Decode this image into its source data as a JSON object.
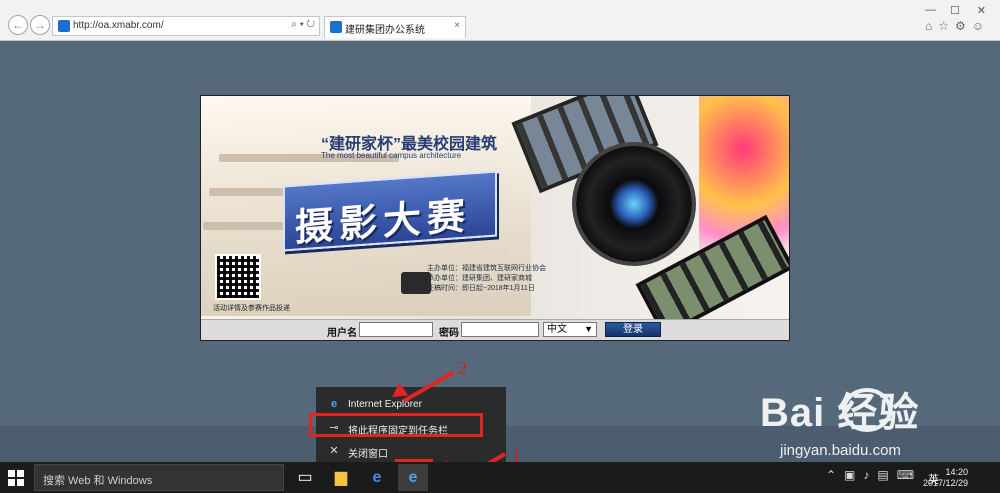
{
  "browser": {
    "address": "http://oa.xmabr.com/",
    "tab_title": "建研集团办公系统",
    "tab_close": "×"
  },
  "banner": {
    "slogan": "“建研家杯”最美校园建筑",
    "subtitle": "The most beautiful campus architecture",
    "contest_title": "摄影大赛",
    "info_lines": [
      "主办单位：福建省建筑互联网行业协会",
      "承办单位：建研集团、建研家商城",
      "征稿时间：即日起~2018年1月11日"
    ],
    "qr_caption": "活动详情及参赛作品投递"
  },
  "login": {
    "username_label": "用户名",
    "password_label": "密码",
    "language_selected": "中文",
    "submit_label": "登录"
  },
  "context_menu": {
    "items": [
      {
        "label": "Internet Explorer",
        "icon": "ie-icon"
      },
      {
        "label": "将此程序固定到任务栏",
        "icon": "pin-icon"
      },
      {
        "label": "关闭窗口",
        "icon": "close-icon"
      }
    ]
  },
  "annotations": {
    "label_1": "1",
    "label_2": "2",
    "color": "#e02525"
  },
  "taskbar": {
    "search_placeholder": "搜索 Web 和 Windows",
    "ime": "英",
    "time": "14:20",
    "date": "2017/12/29"
  },
  "watermark": {
    "brand": "Bai  经验",
    "site": "jingyan.baidu.com"
  }
}
